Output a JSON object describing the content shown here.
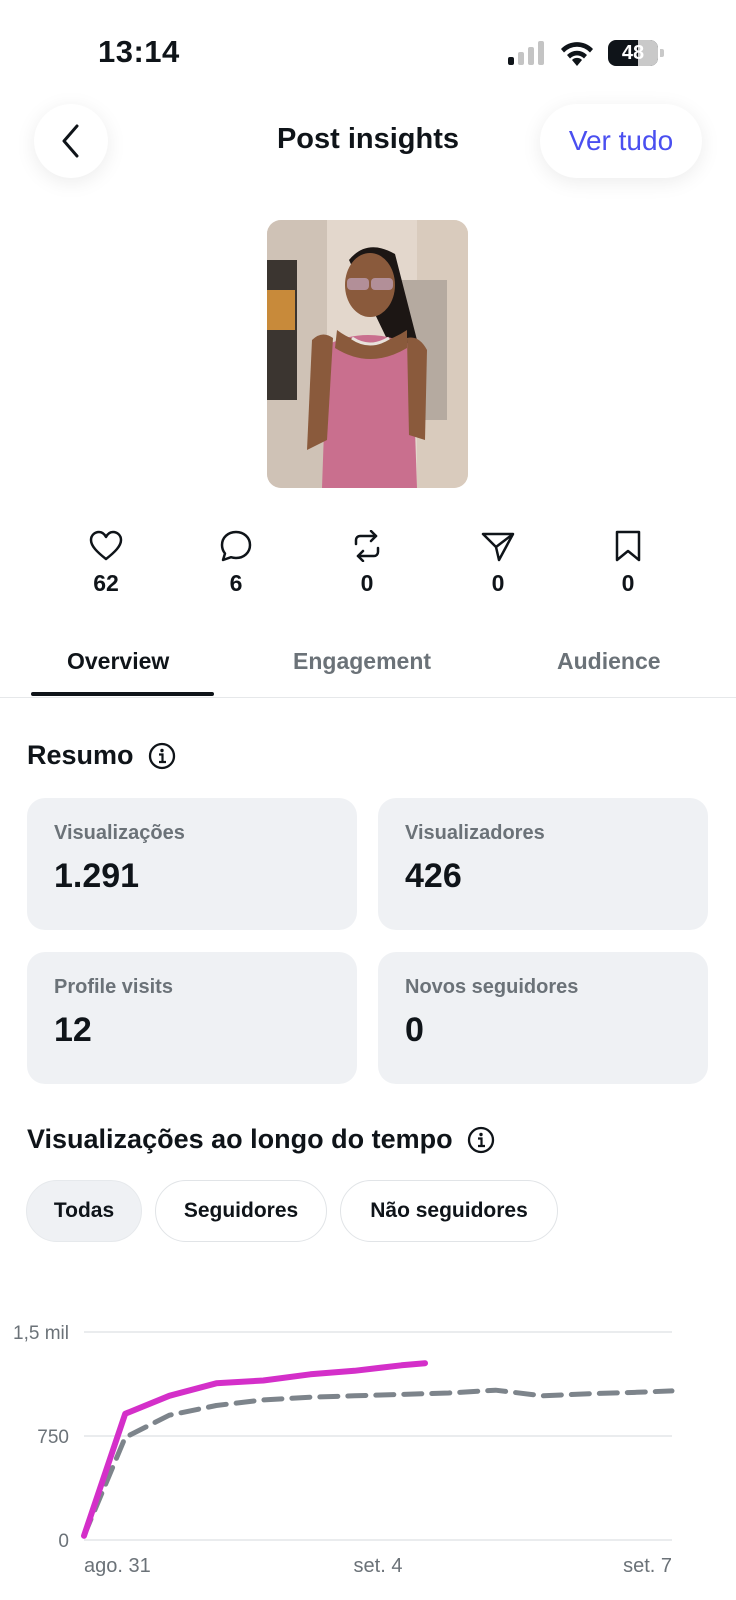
{
  "status": {
    "time": "13:14",
    "battery": "48"
  },
  "header": {
    "title": "Post insights",
    "view_all": "Ver tudo"
  },
  "engagement": [
    {
      "icon": "heart-icon",
      "count": "62"
    },
    {
      "icon": "comment-icon",
      "count": "6"
    },
    {
      "icon": "repost-icon",
      "count": "0"
    },
    {
      "icon": "share-icon",
      "count": "0"
    },
    {
      "icon": "bookmark-icon",
      "count": "0"
    }
  ],
  "tabs": [
    {
      "label": "Overview",
      "active": true
    },
    {
      "label": "Engagement",
      "active": false
    },
    {
      "label": "Audience",
      "active": false
    }
  ],
  "summary": {
    "title": "Resumo",
    "cards": [
      {
        "label": "Visualizações",
        "value": "1.291"
      },
      {
        "label": "Visualizadores",
        "value": "426"
      },
      {
        "label": "Profile visits",
        "value": "12"
      },
      {
        "label": "Novos seguidores",
        "value": "0"
      }
    ]
  },
  "views_over_time": {
    "title": "Visualizações ao longo do tempo",
    "filters": [
      {
        "label": "Todas",
        "active": true
      },
      {
        "label": "Seguidores",
        "active": false
      },
      {
        "label": "Não seguidores",
        "active": false
      }
    ]
  },
  "chart_data": {
    "type": "line",
    "title": "",
    "xlabel": "",
    "ylabel": "",
    "ylim": [
      0,
      1500
    ],
    "y_ticks": [
      {
        "value": 0,
        "label": "0"
      },
      {
        "value": 750,
        "label": "750"
      },
      {
        "value": 1500,
        "label": "1,5 mil"
      }
    ],
    "x_tick_labels": [
      {
        "pos": 0,
        "label": "ago. 31"
      },
      {
        "pos": 0.5,
        "label": "set. 4"
      },
      {
        "pos": 1,
        "label": "set. 7"
      }
    ],
    "grid": true,
    "series": [
      {
        "style": "solid",
        "color": "#d42fc9",
        "x": [
          0,
          0.07,
          0.145,
          0.225,
          0.305,
          0.385,
          0.46,
          0.54,
          0.58
        ],
        "values": [
          30,
          910,
          1040,
          1130,
          1150,
          1195,
          1220,
          1260,
          1275
        ]
      },
      {
        "style": "dashed",
        "color": "#7d848b",
        "x": [
          0,
          0.07,
          0.145,
          0.225,
          0.305,
          0.385,
          0.46,
          0.54,
          0.62,
          0.7,
          0.78,
          0.86,
          0.94,
          1.0
        ],
        "values": [
          30,
          740,
          900,
          970,
          1010,
          1030,
          1040,
          1050,
          1060,
          1080,
          1040,
          1055,
          1065,
          1075
        ]
      }
    ]
  }
}
